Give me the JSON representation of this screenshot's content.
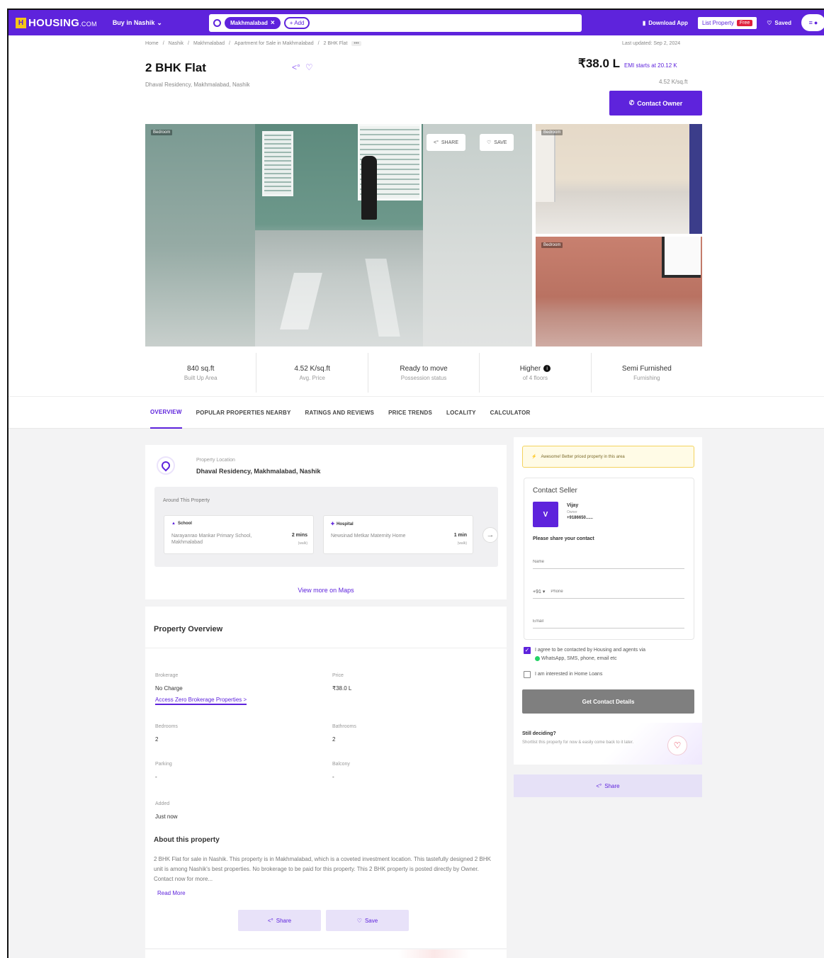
{
  "nav": {
    "logo_mark": "H",
    "logo_text": "HOUSING",
    "logo_suffix": ".COM",
    "city": "Buy in Nashik",
    "search_chip": "Makhmalabad",
    "search_add": "+ Add",
    "download_app": "Download App",
    "list_property": "List Property",
    "free_badge": "Free",
    "saved": "Saved"
  },
  "header": {
    "breadcrumb": [
      "Home",
      "Nashik",
      "Makhmalabad",
      "Apartment for Sale in Makhmalabad",
      "2 BHK Flat"
    ],
    "breadcrumb_more": "•••",
    "last_updated": "Last updated: Sep 2, 2024",
    "title": "2 BHK Flat",
    "subtitle": "Dhaval Residency, Makhmalabad, Nashik",
    "price": "₹38.0 L",
    "emi": "EMI starts at 20.12 K",
    "per_sqft": "4.52 K/sq.ft",
    "contact_owner": "Contact Owner"
  },
  "gallery": {
    "tag_main": "Bedroom",
    "tag_top": "Bedroom",
    "tag_bottom": "Bedroom",
    "share": "SHARE",
    "save": "SAVE"
  },
  "stats": [
    {
      "value": "840 sq.ft",
      "label": "Built Up Area"
    },
    {
      "value": "4.52 K/sq.ft",
      "label": "Avg. Price"
    },
    {
      "value": "Ready to move",
      "label": "Possession status"
    },
    {
      "value": "Higher",
      "label": "of 4 floors"
    },
    {
      "value": "Semi Furnished",
      "label": "Furnishing"
    }
  ],
  "tabs": [
    "OVERVIEW",
    "POPULAR PROPERTIES NEARBY",
    "RATINGS AND REVIEWS",
    "PRICE TRENDS",
    "LOCALITY",
    "CALCULATOR"
  ],
  "location": {
    "label": "Property Location",
    "value": "Dhaval Residency, Makhmalabad, Nashik",
    "around_title": "Around This Property",
    "amenities": [
      {
        "type": "School",
        "name": "Narayanrao Mankar Primary School, Makhmalabad",
        "distance": "2 mins",
        "mode": "(walk)"
      },
      {
        "type": "Hospital",
        "name": "Newsinad Metkar Maternity Home",
        "distance": "1 min",
        "mode": "(walk)"
      }
    ],
    "view_maps": "View more on Maps"
  },
  "overview": {
    "title": "Property Overview",
    "brokerage_label": "Brokerage",
    "brokerage_value": "No Charge",
    "zero_link": "Access Zero Brokerage Properties >",
    "price_label": "Price",
    "price_value": "₹38.0 L",
    "bedrooms_label": "Bedrooms",
    "bedrooms_value": "2",
    "bathrooms_label": "Bathrooms",
    "bathrooms_value": "2",
    "parking_label": "Parking",
    "parking_value": "-",
    "balcony_label": "Balcony",
    "balcony_value": "-",
    "added_label": "Added",
    "added_value": "Just now",
    "about_title": "About this property",
    "about_text": "2 BHK Flat for sale in Nashik. This property is in Makhmalabad, which is a coveted investment location. This tastefully designed 2 BHK unit is among Nashik's best properties. No brokerage to be paid for this property. This 2 BHK property is posted directly by Owner. Contact now for more...",
    "read_more": "Read More",
    "share": "Share",
    "save": "Save"
  },
  "contact": {
    "alert": "Awesome! Better priced property in this area",
    "title": "Contact Seller",
    "avatar": "V",
    "name": "Vijay",
    "role": "Owner",
    "phone": "+9186650......",
    "share_prompt": "Please share your contact",
    "name_placeholder": "Name",
    "country_code": "+91",
    "phone_placeholder": "Phone",
    "email_placeholder": "Email",
    "consent": "I agree to be contacted by Housing and agents via",
    "consent_channels": "WhatsApp, SMS, phone, email etc",
    "home_loans": "I am interested in Home Loans",
    "get_details": "Get Contact Details",
    "deciding_title": "Still deciding?",
    "deciding_text": "Shortlist this property for now & easily come back to it later.",
    "share": "Share"
  }
}
